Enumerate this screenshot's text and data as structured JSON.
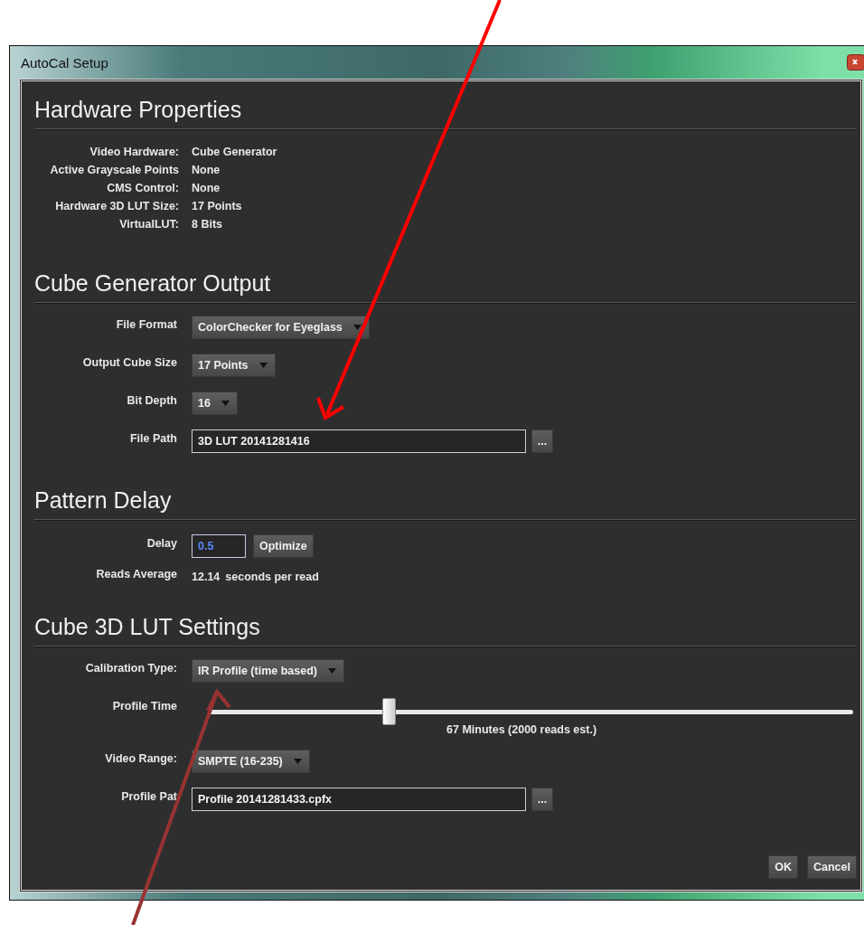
{
  "window": {
    "title": "AutoCal Setup"
  },
  "hardware_properties": {
    "heading": "Hardware Properties",
    "rows": [
      {
        "label": "Video Hardware:",
        "value": "Cube Generator"
      },
      {
        "label": "Active Grayscale Points",
        "value": "None"
      },
      {
        "label": "CMS Control:",
        "value": "None"
      },
      {
        "label": "Hardware 3D LUT Size:",
        "value": "17 Points"
      },
      {
        "label": "VirtualLUT:",
        "value": "8 Bits"
      }
    ]
  },
  "cube_generator_output": {
    "heading": "Cube Generator Output",
    "fields": [
      {
        "kind": "dropdown",
        "label": "File Format",
        "value": "ColorChecker for Eyeglass"
      },
      {
        "kind": "dropdown",
        "label": "Output Cube Size",
        "value": "17 Points"
      },
      {
        "kind": "dropdown",
        "label": "Bit Depth",
        "value": "16"
      },
      {
        "kind": "path",
        "label": "File Path",
        "value": "3D LUT 20141281416",
        "browse": "..."
      }
    ]
  },
  "pattern_delay": {
    "heading": "Pattern Delay",
    "delay_label": "Delay",
    "delay_value": "0.5",
    "optimize_button": "Optimize",
    "reads_label": "Reads Average",
    "reads_value": "12.14",
    "reads_unit": "seconds per read"
  },
  "cube_3d_lut_settings": {
    "heading": "Cube 3D LUT Settings",
    "fields": [
      {
        "kind": "dropdown",
        "label": "Calibration Type:",
        "value": "IR Profile (time based)"
      },
      {
        "kind": "slider",
        "label": "Profile Time",
        "level": 0.28,
        "reading": "67 Minutes (2000 reads est.)"
      },
      {
        "kind": "dropdown",
        "label": "Video Range:",
        "value": "SMPTE (16-235)"
      },
      {
        "kind": "path",
        "label": "Profile Pat",
        "value": "Profile 20141281433.cpfx",
        "browse": "..."
      }
    ]
  },
  "buttons": [
    "OK",
    "Cancel"
  ]
}
